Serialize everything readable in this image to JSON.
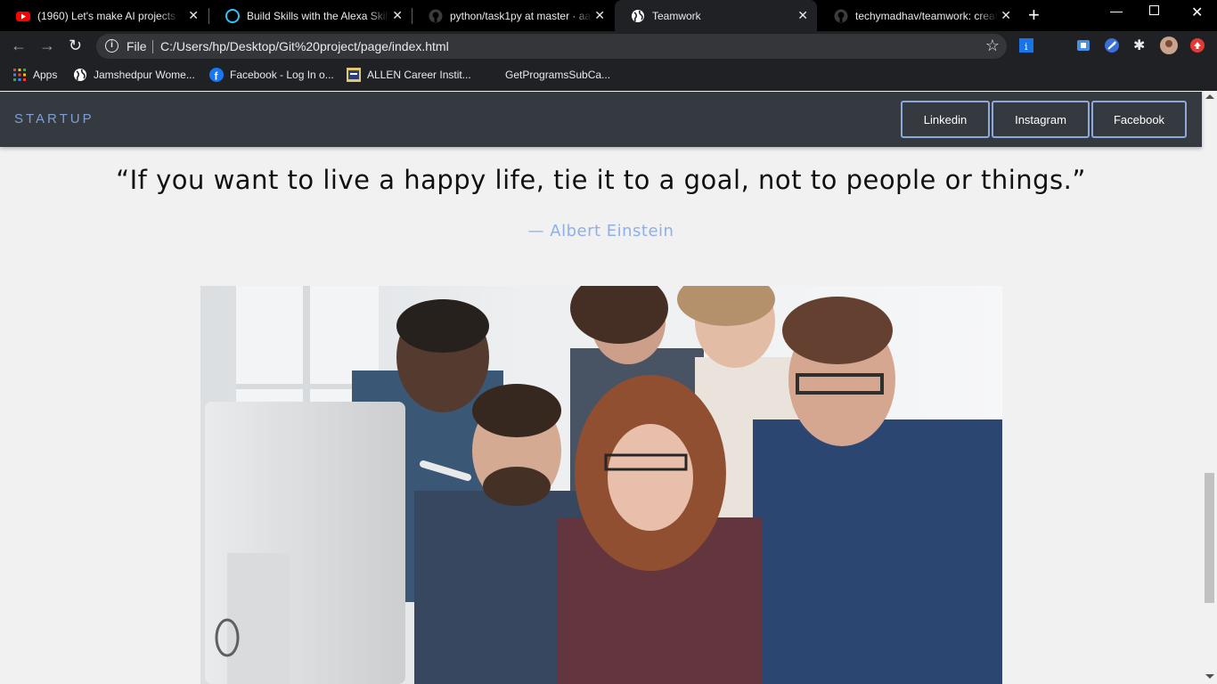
{
  "browser": {
    "tabs": [
      {
        "title": "(1960) Let's make AI projects with",
        "icon": "youtube-icon",
        "active": false
      },
      {
        "title": "Build Skills with the Alexa Skills Kit",
        "icon": "alexa-icon",
        "active": false
      },
      {
        "title": "python/task1py at master · aadi",
        "icon": "github-icon",
        "active": false
      },
      {
        "title": "Teamwork",
        "icon": "globe-icon",
        "active": true
      },
      {
        "title": "techymadhav/teamwork: create",
        "icon": "github-icon",
        "active": false
      }
    ],
    "new_tab": "+",
    "omnibox": {
      "scheme_label": "File",
      "url": "C:/Users/hp/Desktop/Git%20project/page/index.html"
    },
    "bookmarks": [
      {
        "label": "Apps",
        "icon": "apps-grid-icon"
      },
      {
        "label": "Jamshedpur Wome...",
        "icon": "globe-icon"
      },
      {
        "label": "Facebook - Log In o...",
        "icon": "facebook-icon"
      },
      {
        "label": "ALLEN Career Instit...",
        "icon": "allen-icon"
      },
      {
        "label": "GetProgramsSubCa...",
        "icon": "blank-icon"
      }
    ]
  },
  "site": {
    "brand": "STARTUP",
    "nav": {
      "linkedin": "Linkedin",
      "instagram": "Instagram",
      "facebook": "Facebook"
    },
    "quote": "“If you want to live a happy life, tie it to a goal, not to people or things.”",
    "author": "— Albert Einstein",
    "colors": {
      "navbar_bg": "#343a40",
      "brand": "#7f9fd4",
      "button_border": "#8fa8dc",
      "author": "#8fb0e6",
      "page_bg": "#f1f1f1"
    }
  }
}
